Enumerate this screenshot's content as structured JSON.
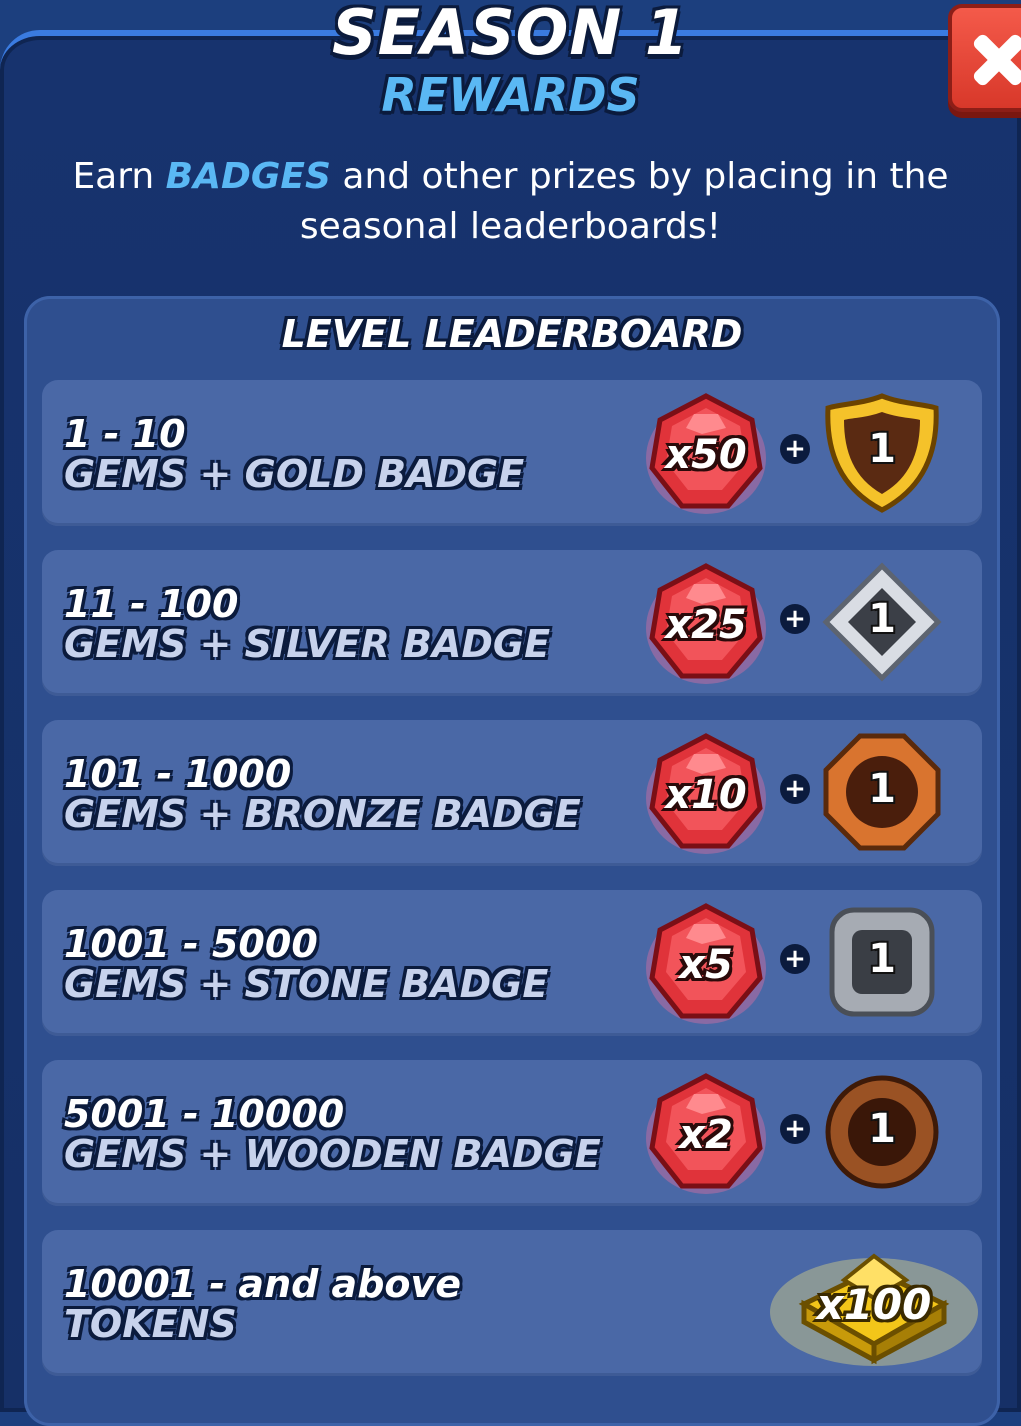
{
  "header": {
    "title": "SEASON 1",
    "subtitle": "REWARDS"
  },
  "description": {
    "prefix": "Earn ",
    "highlight": "BADGES",
    "suffix": " and other prizes by placing in the seasonal leaderboards!"
  },
  "leaderboard": {
    "title": "LEVEL LEADERBOARD",
    "rows": [
      {
        "rank": "1 - 10",
        "reward": "GEMS + GOLD BADGE",
        "gems": "x50",
        "badge_type": "gold",
        "badge_number": "1"
      },
      {
        "rank": "11 - 100",
        "reward": "GEMS + SILVER BADGE",
        "gems": "x25",
        "badge_type": "silver",
        "badge_number": "1"
      },
      {
        "rank": "101 - 1000",
        "reward": "GEMS + BRONZE BADGE",
        "gems": "x10",
        "badge_type": "bronze",
        "badge_number": "1"
      },
      {
        "rank": "1001 - 5000",
        "reward": "GEMS + STONE BADGE",
        "gems": "x5",
        "badge_type": "stone",
        "badge_number": "1"
      },
      {
        "rank": "5001 - 10000",
        "reward": "GEMS + WOODEN BADGE",
        "gems": "x2",
        "badge_type": "wooden",
        "badge_number": "1"
      },
      {
        "rank": "10001 - and above",
        "reward": "TOKENS",
        "tokens": "x100"
      }
    ],
    "plus_sign": "+"
  },
  "icons": {
    "close": "close-icon",
    "gem": "gem-pile-icon",
    "token": "token-pile-icon"
  },
  "colors": {
    "background": "#17336e",
    "accent": "#5ab8f4",
    "row": "#4a68a6",
    "close_button": "#e4473a"
  }
}
